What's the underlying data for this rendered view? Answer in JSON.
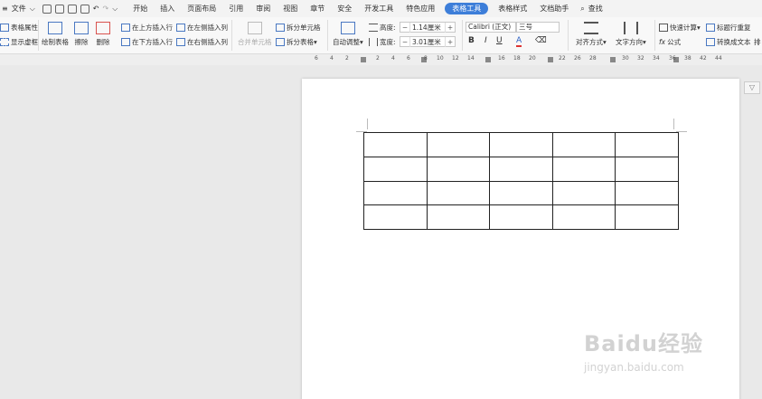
{
  "menu": {
    "file_label": "文件",
    "tabs": [
      "开始",
      "插入",
      "页面布局",
      "引用",
      "审阅",
      "视图",
      "章节",
      "安全",
      "开发工具",
      "特色应用",
      "表格工具",
      "表格样式",
      "文档助手"
    ],
    "active_tab": "表格工具",
    "search_label": "查找"
  },
  "ribbon": {
    "table_props": "表格属性",
    "show_gridlines": "显示虚框",
    "draw_table": "绘制表格",
    "erase": "擦除",
    "delete": "删除",
    "insert_row_above": "在上方插入行",
    "insert_row_below": "在下方插入行",
    "insert_col_left": "在左侧插入列",
    "insert_col_right": "在右侧插入列",
    "merge_cells": "合并单元格",
    "split_cells": "拆分单元格",
    "split_table": "拆分表格",
    "auto_fit": "自动调整",
    "height_label": "高度:",
    "height_value": "1.14厘米",
    "width_label": "宽度:",
    "width_value": "3.01厘米",
    "font_name": "Calibri (正文)",
    "font_size": "三号",
    "bold": "B",
    "italic": "I",
    "underline": "U",
    "font_color": "A",
    "align": "对齐方式",
    "text_direction": "文字方向",
    "quick_calc": "快速计算",
    "formula": "公式",
    "repeat_header": "标题行重复",
    "convert_text": "转换成文本",
    "sort_partial": "排"
  },
  "ruler": {
    "ticks": [
      "6",
      "4",
      "2",
      "2",
      "4",
      "6",
      "8",
      "10",
      "12",
      "14",
      "16",
      "18",
      "20",
      "22",
      "26",
      "28",
      "30",
      "32",
      "34",
      "36",
      "38",
      "42",
      "44",
      "46"
    ]
  },
  "watermark": {
    "text": "Baidu经验",
    "url": "jingyan.baidu.com"
  },
  "colors": {
    "active_tab": "#3d7ed9",
    "page": "#ffffff",
    "background": "#e9e9e9"
  }
}
